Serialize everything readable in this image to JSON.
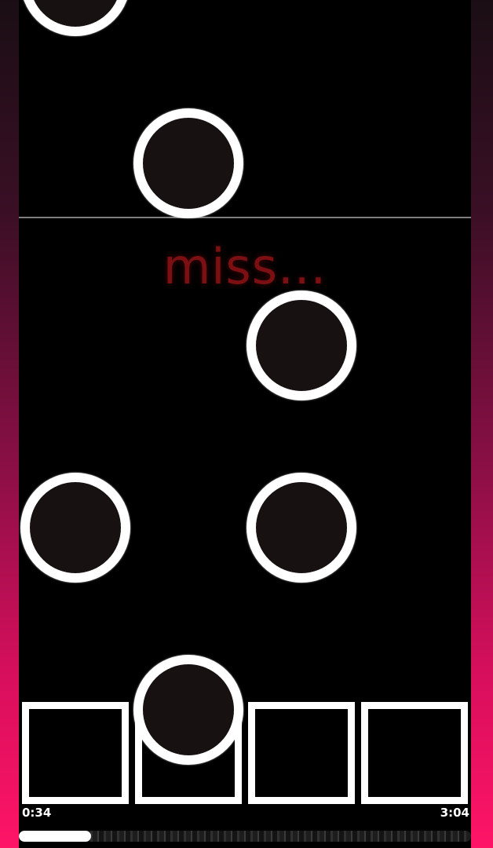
{
  "game": {
    "judgment_text": "miss...",
    "time_elapsed": "0:34",
    "time_total": "3:04",
    "progress": 0.16,
    "lanes": 4
  },
  "colors": {
    "background_gradient_top": "#1a0e14",
    "background_gradient_bottom": "#ff1466",
    "playfield": "#000000",
    "note_fill": "#171111",
    "note_ring": "#ffffff",
    "judgment": "#7c0f12",
    "judge_line": "#8d8d8d"
  },
  "notes": [
    {
      "lane": 1
    },
    {
      "lane": 2
    },
    {
      "lane": 3
    },
    {
      "lane": 1
    },
    {
      "lane": 3
    },
    {
      "lane": 2
    }
  ]
}
